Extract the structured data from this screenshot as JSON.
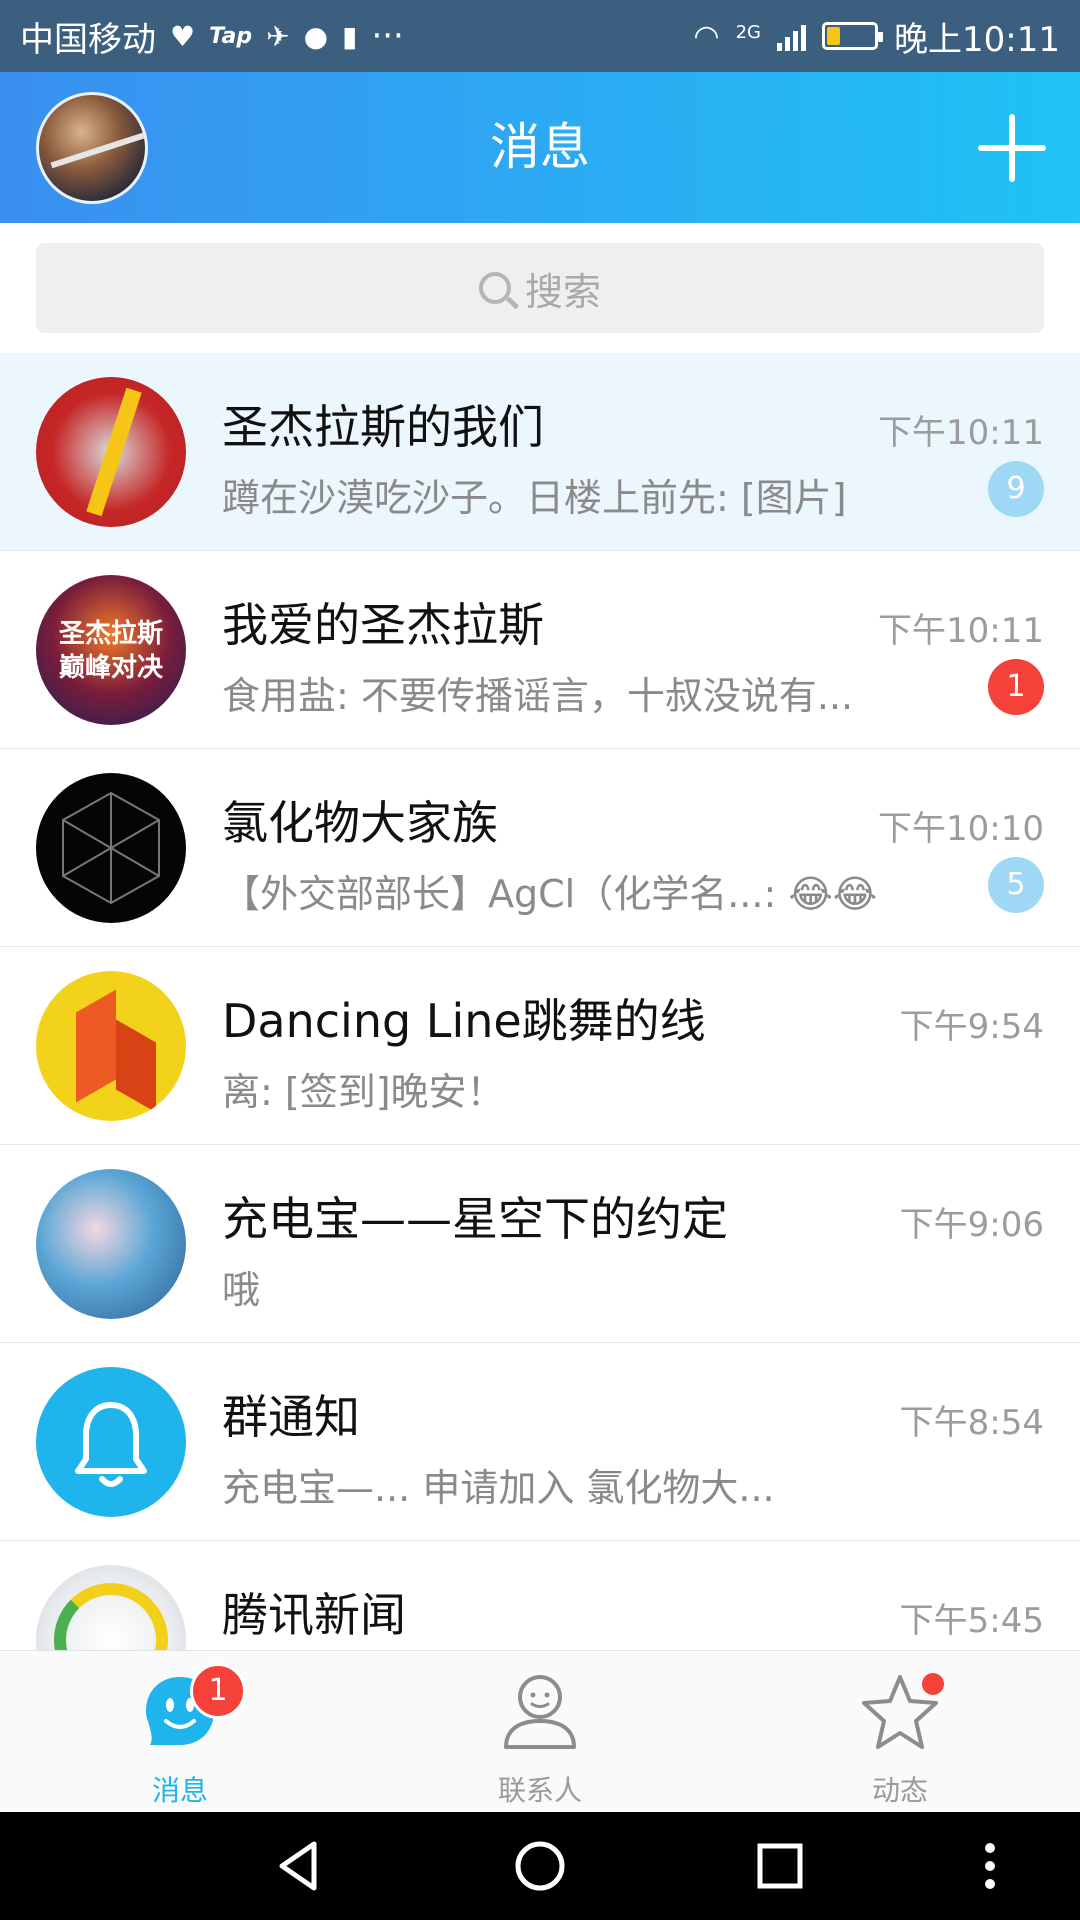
{
  "status_bar": {
    "carrier": "中国移动",
    "app_icons": [
      "heart-pulse-icon",
      "tap-icon",
      "bird-icon",
      "chat-bubble-icon",
      "battery-small-icon"
    ],
    "tap_text": "Tap",
    "more": "···",
    "network": "2G",
    "time": "晚上10:11",
    "battery_level": 0.25
  },
  "header": {
    "title": "消息"
  },
  "search": {
    "placeholder": "搜索"
  },
  "chats": [
    {
      "title": "圣杰拉斯的我们",
      "message": "蹲在沙漠吃沙子。日楼上前先: [图片]",
      "time": "下午10:11",
      "badge": "9",
      "badge_style": "muted",
      "highlight": true
    },
    {
      "title": "我爱的圣杰拉斯",
      "message": "食用盐: 不要传播谣言，十叔没说有...",
      "time": "下午10:11",
      "badge": "1",
      "badge_style": "red",
      "avatar_text_1": "圣杰拉斯",
      "avatar_text_2": "巅峰对决"
    },
    {
      "title": "氯化物大家族",
      "message": "【外交部部长】AgCl（化学名...: 😂😂",
      "time": "下午10:10",
      "badge": "5",
      "badge_style": "muted"
    },
    {
      "title": "Dancing Line跳舞的线",
      "message": "离: [签到]晚安！",
      "time": "下午9:54"
    },
    {
      "title": "充电宝——星空下的约定",
      "message": "哦",
      "time": "下午9:06"
    },
    {
      "title": "群通知",
      "message": "充电宝—... 申请加入 氯化物大...",
      "time": "下午8:54"
    },
    {
      "title": "腾讯新闻",
      "message": "",
      "time": "下午5:45"
    }
  ],
  "tabs": [
    {
      "label": "消息",
      "badge": "1",
      "active": true
    },
    {
      "label": "联系人"
    },
    {
      "label": "动态",
      "dot": true
    }
  ],
  "colors": {
    "accent": "#1fb4ec",
    "header_start": "#3a8ff0",
    "header_end": "#1fc3f5",
    "badge_red": "#f4423a",
    "badge_muted": "#9fd8f5"
  }
}
